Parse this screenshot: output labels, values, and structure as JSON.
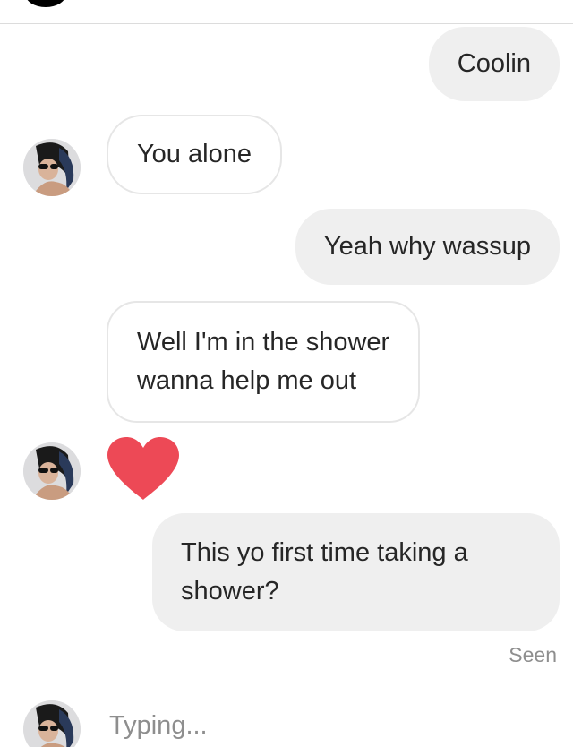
{
  "conversation": {
    "messages": [
      {
        "sender": "me",
        "text": "Coolin"
      },
      {
        "sender": "them",
        "text": "You alone"
      },
      {
        "sender": "me",
        "text": "Yeah why wassup"
      },
      {
        "sender": "them",
        "lines": [
          "Well I'm in the shower",
          "wanna help me out"
        ]
      },
      {
        "sender": "them",
        "reaction": "heart-icon"
      },
      {
        "sender": "me",
        "lines": [
          "This yo first time taking a",
          "shower?"
        ]
      }
    ],
    "seen_label": "Seen",
    "typing_label": "Typing..."
  },
  "colors": {
    "sent_bubble": "#efefef",
    "received_border": "#e6e6e6",
    "heart": "#ed4956",
    "meta_text": "#8e8e8e"
  }
}
